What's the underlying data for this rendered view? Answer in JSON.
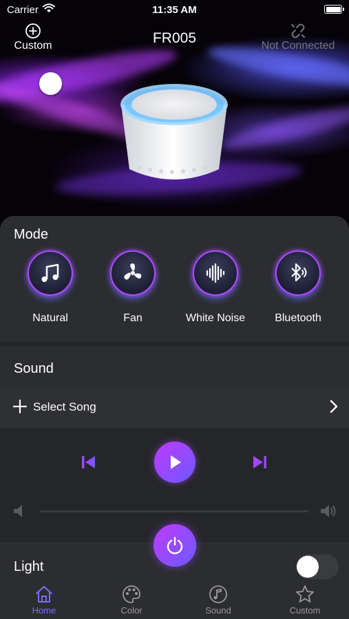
{
  "status_bar": {
    "carrier": "Carrier",
    "time": "11:35 AM"
  },
  "header": {
    "custom_label": "Custom",
    "device_name": "FR005",
    "connection_status": "Not Connected"
  },
  "mode_section": {
    "title": "Mode",
    "modes": [
      {
        "label": "Natural",
        "icon": "music-note-icon"
      },
      {
        "label": "Fan",
        "icon": "fan-icon"
      },
      {
        "label": "White Noise",
        "icon": "waveform-icon"
      },
      {
        "label": "Bluetooth",
        "icon": "bluetooth-icon"
      }
    ]
  },
  "sound_section": {
    "title": "Sound",
    "select_song_label": "Select Song",
    "volume_level": 0.0,
    "playing": false
  },
  "light_section": {
    "title": "Light",
    "enabled": false
  },
  "tabs": [
    {
      "label": "Home",
      "icon": "home-icon",
      "active": true
    },
    {
      "label": "Color",
      "icon": "palette-icon",
      "active": false
    },
    {
      "label": "Sound",
      "icon": "music-note-icon",
      "active": false
    },
    {
      "label": "Custom",
      "icon": "star-icon",
      "active": false
    }
  ],
  "colors": {
    "accent_purple": "#c13aff",
    "accent_blue": "#6a5bff",
    "active_tab": "#7a6cff",
    "panel_bg": "#2c2d30"
  }
}
